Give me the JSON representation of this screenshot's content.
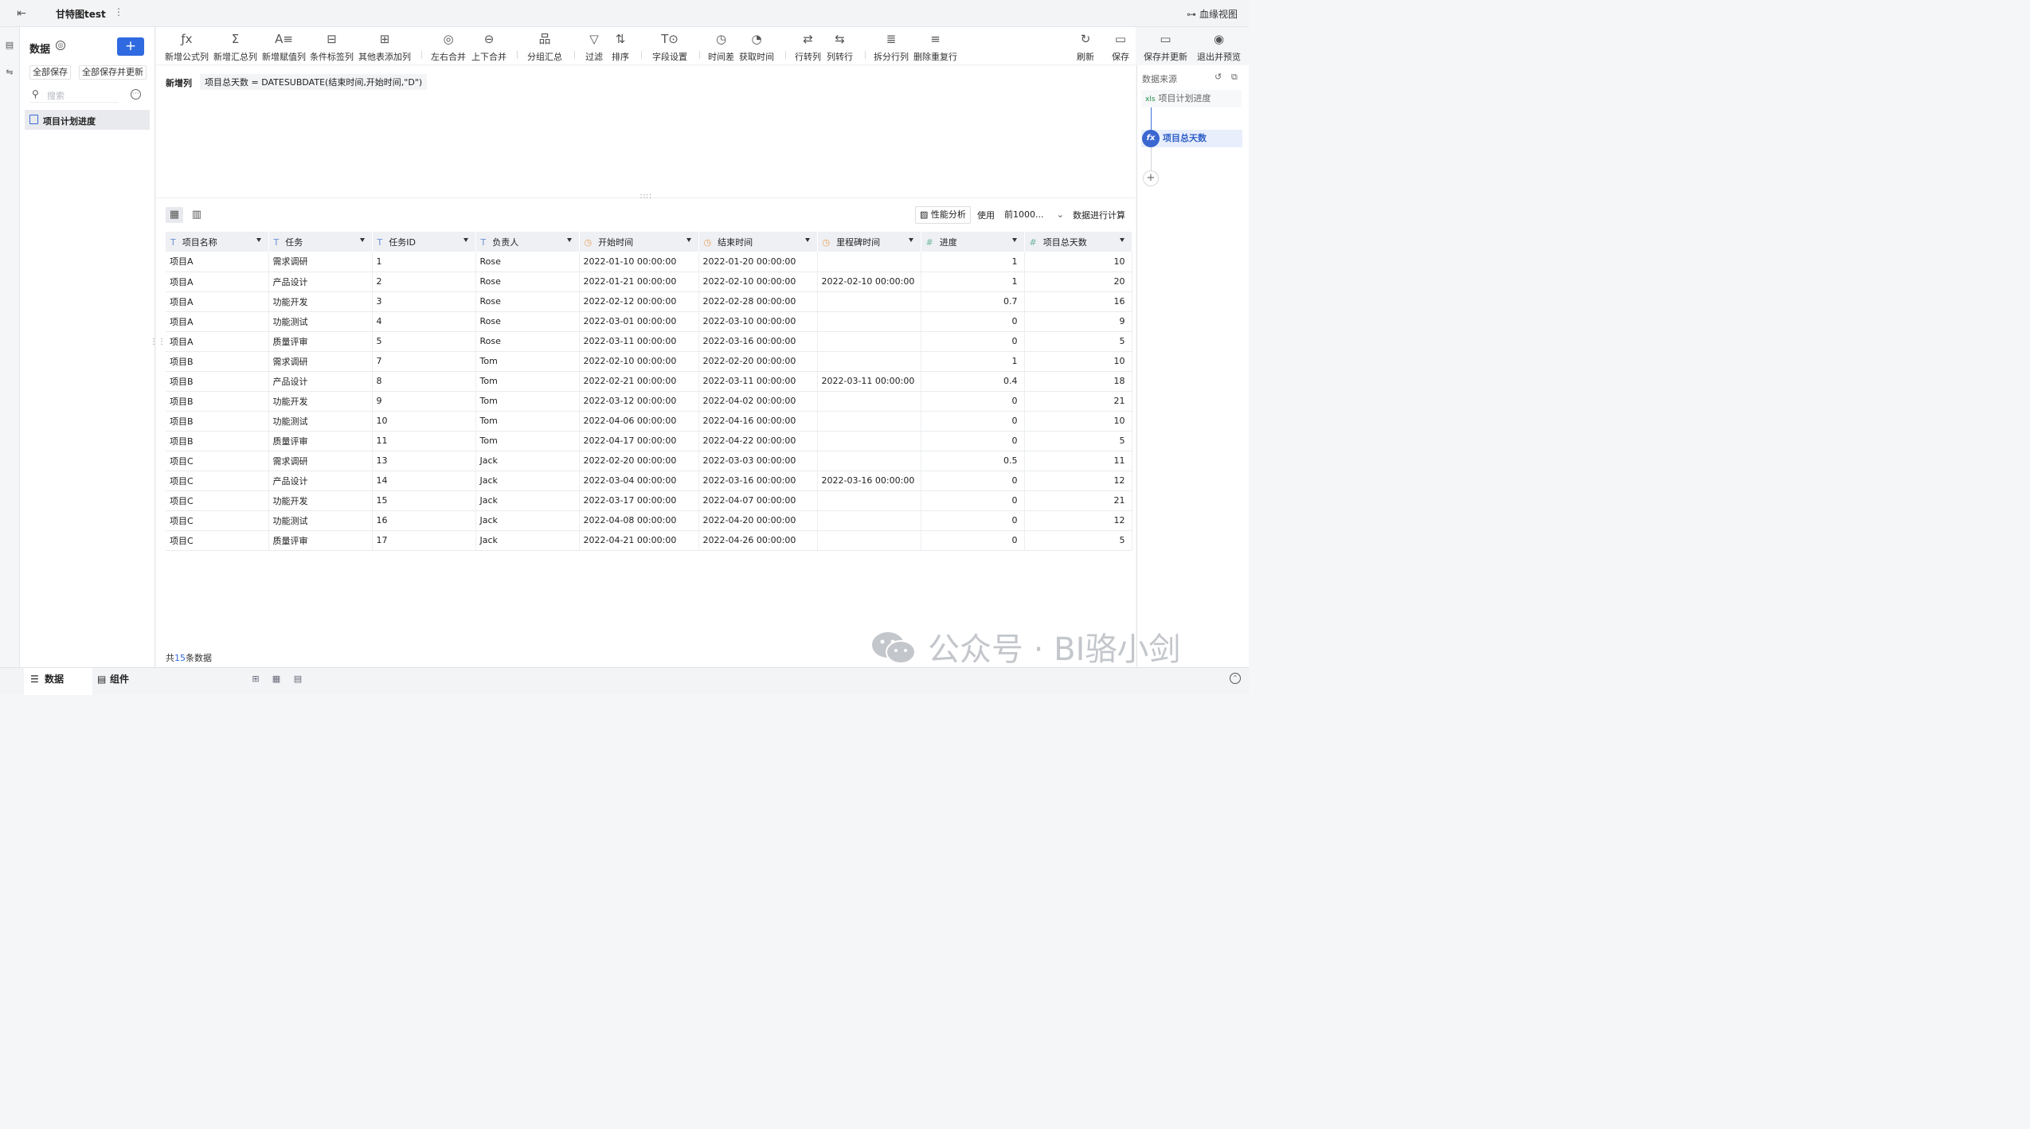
{
  "topbar": {
    "title": "甘特图test",
    "lineage": "血缘视图"
  },
  "sidebar": {
    "header": "数据",
    "add_label": "+",
    "save_all": "全部保存",
    "save_all_update": "全部保存并更新",
    "search_placeholder": "搜索",
    "items": [
      {
        "label": "项目计划进度"
      }
    ]
  },
  "toolbar": {
    "items": [
      {
        "icon": "ƒx",
        "label": "新增公式列"
      },
      {
        "icon": "Σ",
        "label": "新增汇总列"
      },
      {
        "icon": "A≡",
        "label": "新增赋值列"
      },
      {
        "icon": "⊟",
        "label": "条件标签列"
      },
      {
        "icon": "⊞",
        "label": "其他表添加列"
      },
      {
        "icon": "◎",
        "label": "左右合并"
      },
      {
        "icon": "⊖",
        "label": "上下合并"
      },
      {
        "icon": "品",
        "label": "分组汇总"
      },
      {
        "icon": "▽",
        "label": "过滤"
      },
      {
        "icon": "⇅",
        "label": "排序"
      },
      {
        "icon": "T⊙",
        "label": "字段设置"
      },
      {
        "icon": "◷",
        "label": "时间差"
      },
      {
        "icon": "◔",
        "label": "获取时间"
      },
      {
        "icon": "⇄",
        "label": "行转列"
      },
      {
        "icon": "⇆",
        "label": "列转行"
      },
      {
        "icon": "≣",
        "label": "拆分行列"
      },
      {
        "icon": "≡",
        "label": "删除重复行"
      }
    ],
    "right": [
      {
        "icon": "↻",
        "label": "刷新"
      },
      {
        "icon": "▭",
        "label": "保存"
      },
      {
        "icon": "▭",
        "label": "保存并更新"
      },
      {
        "icon": "◉",
        "label": "退出并预览"
      }
    ]
  },
  "formula": {
    "label": "新增列",
    "expression": "项目总天数 = DATESUBDATE(结束时间,开始时间,\"D\")"
  },
  "preview": {
    "perf_label": "性能分析",
    "use_label": "使用",
    "select_value": "前1000...",
    "calc_label": "数据进行计算",
    "columns": [
      {
        "type": "T",
        "name": "项目名称"
      },
      {
        "type": "T",
        "name": "任务"
      },
      {
        "type": "T",
        "name": "任务ID"
      },
      {
        "type": "T",
        "name": "负责人"
      },
      {
        "type": "time",
        "name": "开始时间"
      },
      {
        "type": "time",
        "name": "结束时间"
      },
      {
        "type": "time",
        "name": "里程碑时间"
      },
      {
        "type": "#",
        "name": "进度"
      },
      {
        "type": "#",
        "name": "项目总天数"
      }
    ],
    "rows": [
      [
        "项目A",
        "需求调研",
        "1",
        "Rose",
        "2022-01-10 00:00:00",
        "2022-01-20 00:00:00",
        "",
        "1",
        "10"
      ],
      [
        "项目A",
        "产品设计",
        "2",
        "Rose",
        "2022-01-21 00:00:00",
        "2022-02-10 00:00:00",
        "2022-02-10 00:00:00",
        "1",
        "20"
      ],
      [
        "项目A",
        "功能开发",
        "3",
        "Rose",
        "2022-02-12 00:00:00",
        "2022-02-28 00:00:00",
        "",
        "0.7",
        "16"
      ],
      [
        "项目A",
        "功能测试",
        "4",
        "Rose",
        "2022-03-01 00:00:00",
        "2022-03-10 00:00:00",
        "",
        "0",
        "9"
      ],
      [
        "项目A",
        "质量评审",
        "5",
        "Rose",
        "2022-03-11 00:00:00",
        "2022-03-16 00:00:00",
        "",
        "0",
        "5"
      ],
      [
        "项目B",
        "需求调研",
        "7",
        "Tom",
        "2022-02-10 00:00:00",
        "2022-02-20 00:00:00",
        "",
        "1",
        "10"
      ],
      [
        "项目B",
        "产品设计",
        "8",
        "Tom",
        "2022-02-21 00:00:00",
        "2022-03-11 00:00:00",
        "2022-03-11 00:00:00",
        "0.4",
        "18"
      ],
      [
        "项目B",
        "功能开发",
        "9",
        "Tom",
        "2022-03-12 00:00:00",
        "2022-04-02 00:00:00",
        "",
        "0",
        "21"
      ],
      [
        "项目B",
        "功能测试",
        "10",
        "Tom",
        "2022-04-06 00:00:00",
        "2022-04-16 00:00:00",
        "",
        "0",
        "10"
      ],
      [
        "项目B",
        "质量评审",
        "11",
        "Tom",
        "2022-04-17 00:00:00",
        "2022-04-22 00:00:00",
        "",
        "0",
        "5"
      ],
      [
        "项目C",
        "需求调研",
        "13",
        "Jack",
        "2022-02-20 00:00:00",
        "2022-03-03 00:00:00",
        "",
        "0.5",
        "11"
      ],
      [
        "项目C",
        "产品设计",
        "14",
        "Jack",
        "2022-03-04 00:00:00",
        "2022-03-16 00:00:00",
        "2022-03-16 00:00:00",
        "0",
        "12"
      ],
      [
        "项目C",
        "功能开发",
        "15",
        "Jack",
        "2022-03-17 00:00:00",
        "2022-04-07 00:00:00",
        "",
        "0",
        "21"
      ],
      [
        "项目C",
        "功能测试",
        "16",
        "Jack",
        "2022-04-08 00:00:00",
        "2022-04-20 00:00:00",
        "",
        "0",
        "12"
      ],
      [
        "项目C",
        "质量评审",
        "17",
        "Jack",
        "2022-04-21 00:00:00",
        "2022-04-26 00:00:00",
        "",
        "0",
        "5"
      ]
    ],
    "count_prefix": "共",
    "count": "15",
    "count_suffix": "条数据"
  },
  "right_panel": {
    "header": "数据来源",
    "source": "项目计划进度",
    "source_badge": "xls",
    "node": "项目总天数",
    "node_icon": "fx",
    "add_label": "+"
  },
  "watermark": {
    "text": "公众号 · BI骆小剑"
  },
  "bottombar": {
    "tab_data": "数据",
    "tab_component": "组件"
  },
  "colors": {
    "accent": "#2f6ae0",
    "node_bg": "#e8eefc"
  }
}
